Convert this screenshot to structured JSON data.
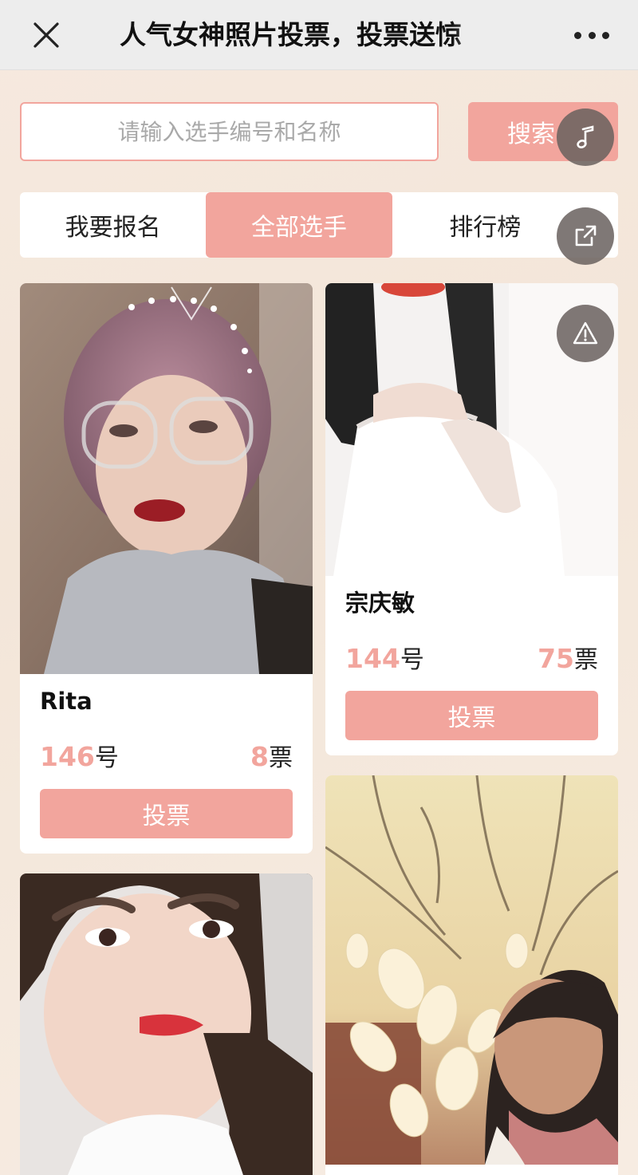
{
  "navbar": {
    "title": "人气女神照片投票，投票送惊"
  },
  "search": {
    "placeholder": "请输入选手编号和名称",
    "button_label": "搜索"
  },
  "tabs": [
    {
      "label": "我要报名",
      "active": false
    },
    {
      "label": "全部选手",
      "active": true
    },
    {
      "label": "排行榜",
      "active": false
    }
  ],
  "colors": {
    "accent": "#f2a59d",
    "floating_button": "#69605e"
  },
  "contestants": [
    {
      "name": "Rita",
      "number": "146",
      "number_unit": "号",
      "votes": "8",
      "votes_unit": "票",
      "vote_label": "投票"
    },
    {
      "name": "宗庆敏",
      "number": "144",
      "number_unit": "号",
      "votes": "75",
      "votes_unit": "票",
      "vote_label": "投票"
    },
    {
      "name": "",
      "number": "",
      "number_unit": "",
      "votes": "",
      "votes_unit": "",
      "vote_label": ""
    },
    {
      "name": "",
      "number": "",
      "number_unit": "",
      "votes": "",
      "votes_unit": "",
      "vote_label": ""
    }
  ],
  "floating_icons": [
    "music-note-icon",
    "share-icon",
    "report-warning-icon"
  ]
}
